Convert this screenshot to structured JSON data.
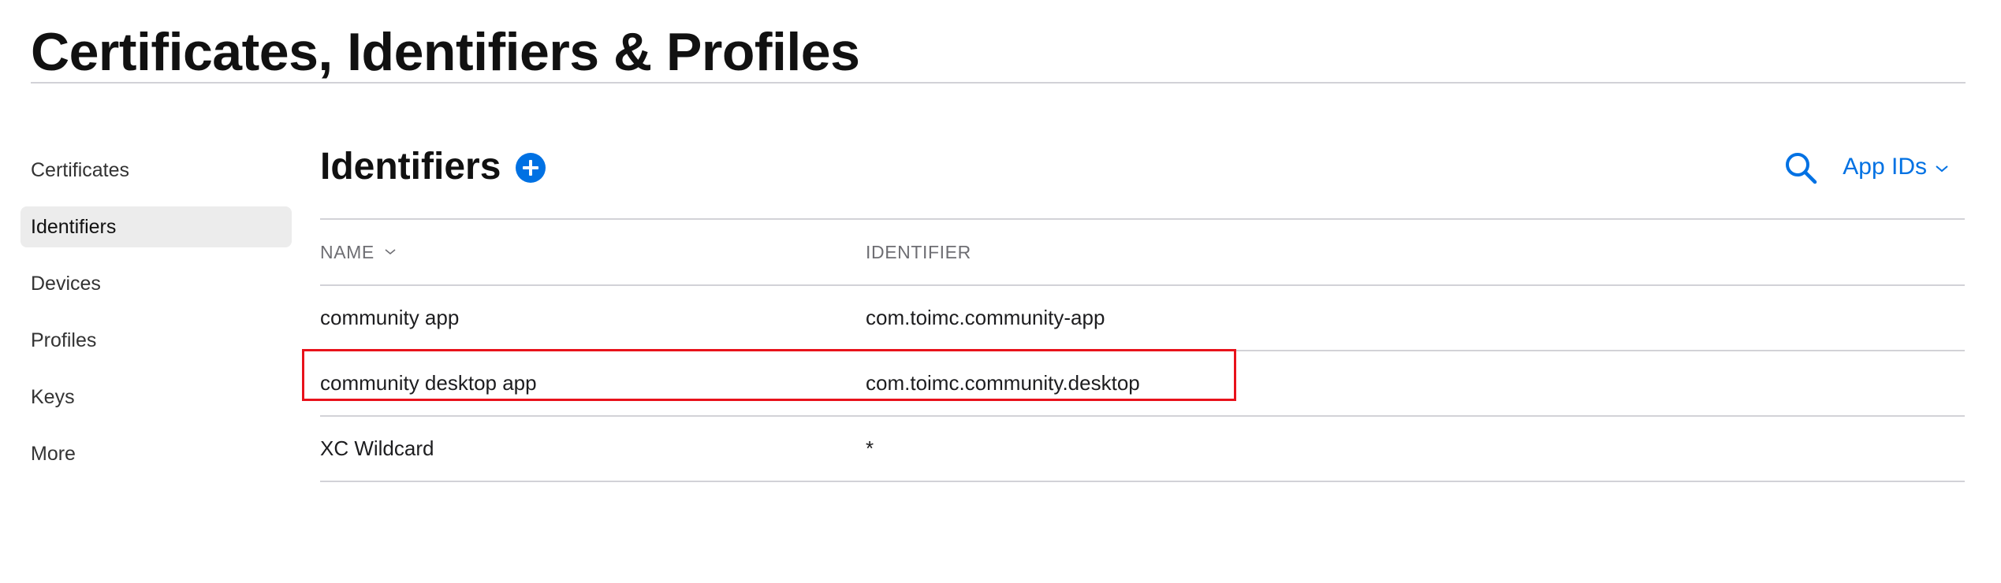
{
  "page": {
    "title": "Certificates, Identifiers & Profiles"
  },
  "sidebar": {
    "items": [
      {
        "label": "Certificates",
        "active": false
      },
      {
        "label": "Identifiers",
        "active": true
      },
      {
        "label": "Devices",
        "active": false
      },
      {
        "label": "Profiles",
        "active": false
      },
      {
        "label": "Keys",
        "active": false
      },
      {
        "label": "More",
        "active": false
      }
    ]
  },
  "main": {
    "section_title": "Identifiers",
    "add_icon": "plus-circle-icon",
    "search_icon": "search-icon",
    "filter": {
      "selected": "App IDs",
      "icon": "chevron-down-icon"
    },
    "table": {
      "columns": [
        {
          "label": "NAME",
          "sortable": true
        },
        {
          "label": "IDENTIFIER",
          "sortable": false
        }
      ],
      "rows": [
        {
          "name": "community app",
          "identifier": "com.toimc.community-app"
        },
        {
          "name": "community desktop app",
          "identifier": "com.toimc.community.desktop"
        },
        {
          "name": "XC Wildcard",
          "identifier": "*"
        }
      ]
    }
  },
  "colors": {
    "accent": "#0071e3",
    "highlight": "#e8121b",
    "active_bg": "#ececec",
    "divider": "#d2d2d7"
  }
}
